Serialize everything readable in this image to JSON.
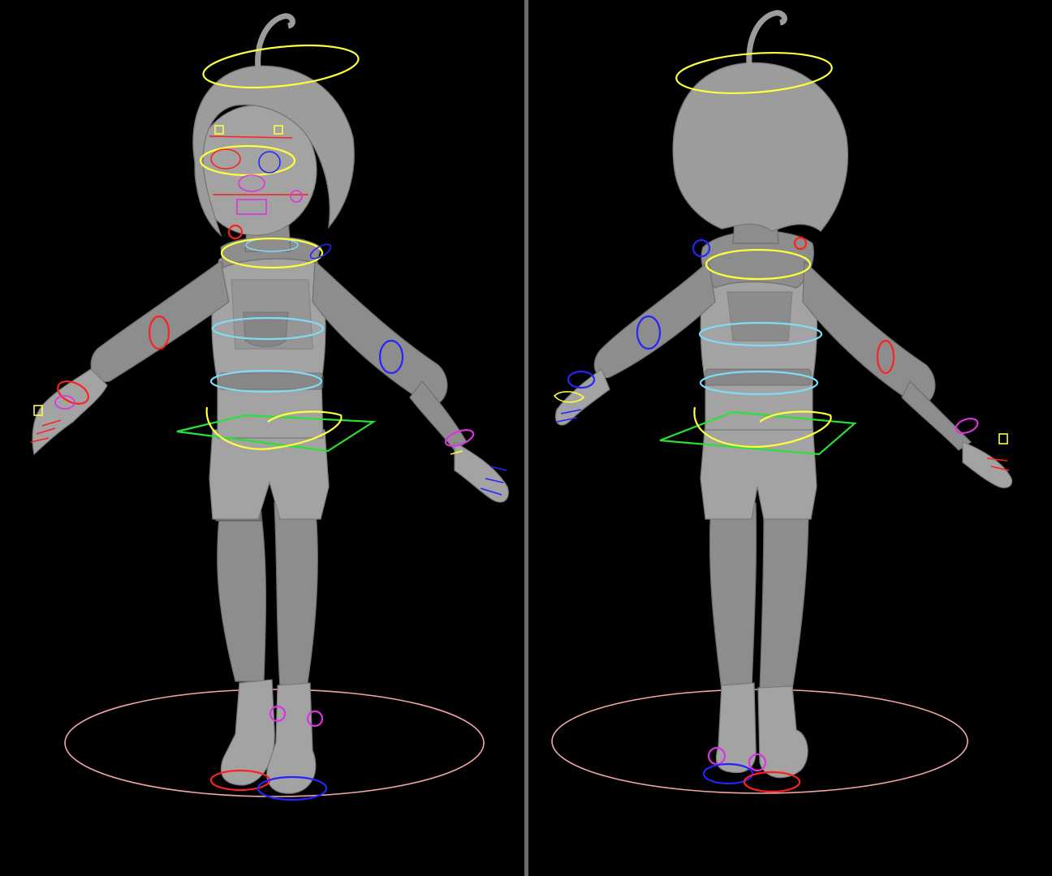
{
  "scene": {
    "background": "#000000",
    "divider_color": "#6b6b6b",
    "views": [
      "front",
      "back"
    ]
  },
  "controller_colors": {
    "head": "#ffff3c",
    "torso": "#7fdcf5",
    "root": "#27e234",
    "left": "#ff2020",
    "right": "#2424ff",
    "ik_feet": "#e030e0",
    "ground": "#f2a6a6"
  }
}
